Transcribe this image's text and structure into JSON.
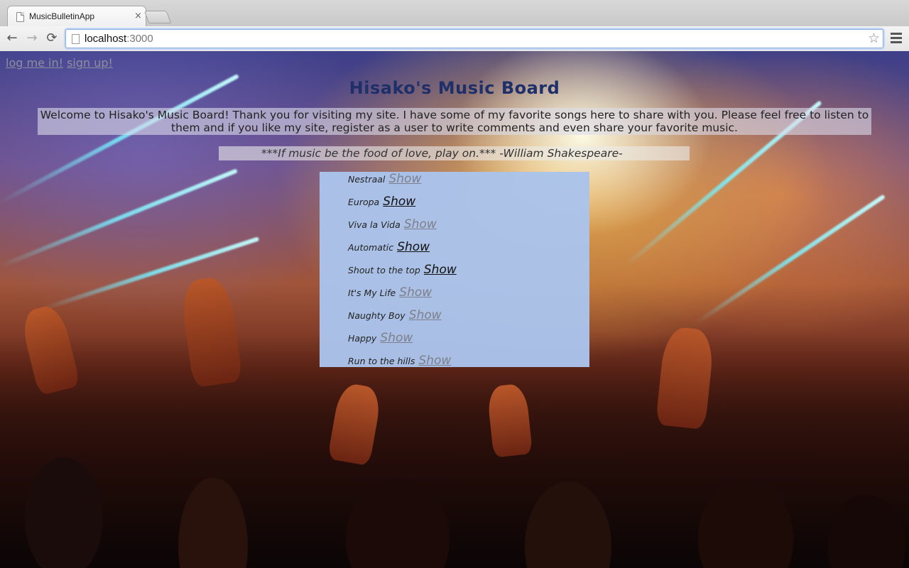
{
  "browser": {
    "tab_title": "MusicBulletinApp",
    "tab_close": "×",
    "url_host": "localhost",
    "url_port": ":3000",
    "back_icon": "←",
    "forward_icon": "→",
    "reload_icon": "⟳",
    "star_icon": "☆"
  },
  "auth": {
    "login_label": "log me in!",
    "signup_label": "sign up!"
  },
  "page": {
    "title": "Hisako's Music Board",
    "welcome": "Welcome to Hisako's Music Board! Thank you for visiting my site. I have some of my favorite songs here to share with you. Please feel free to listen to them and if you like my site, register as a user to write comments and even share your favorite music.",
    "quote": "***If music be the food of love, play on.*** -William Shakespeare-"
  },
  "songs": [
    {
      "name": "Nestraal",
      "link": "Show",
      "visited": true
    },
    {
      "name": "Europa",
      "link": "Show",
      "visited": false
    },
    {
      "name": "Viva la Vida",
      "link": "Show",
      "visited": true
    },
    {
      "name": "Automatic",
      "link": "Show",
      "visited": false
    },
    {
      "name": "Shout to the top",
      "link": "Show",
      "visited": false
    },
    {
      "name": "It's My Life",
      "link": "Show",
      "visited": true
    },
    {
      "name": "Naughty Boy",
      "link": "Show",
      "visited": true
    },
    {
      "name": "Happy",
      "link": "Show",
      "visited": true
    },
    {
      "name": "Run to the hills",
      "link": "Show",
      "visited": true
    }
  ]
}
